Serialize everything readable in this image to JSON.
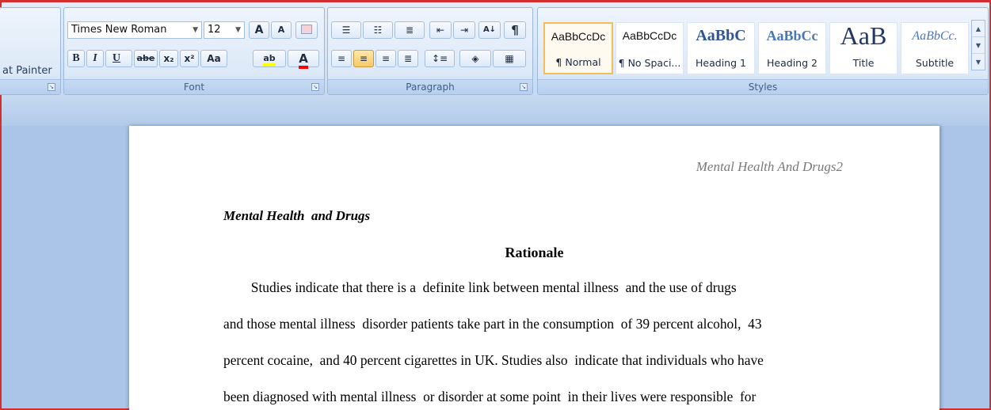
{
  "clipboard": {
    "format_painter_label": "at Painter"
  },
  "font": {
    "name": "Times New Roman",
    "size": "12",
    "group_label": "Font",
    "grow_label": "A",
    "shrink_label": "A",
    "bold_label": "B",
    "italic_label": "I",
    "underline_label": "U",
    "strike_label": "abe",
    "subscript_label": "x₂",
    "superscript_label": "x²",
    "case_label": "Aa",
    "highlight_label": "ab",
    "fontcolor_label": "A"
  },
  "paragraph": {
    "group_label": "Paragraph",
    "show_marks_label": "¶"
  },
  "styles": {
    "group_label": "Styles",
    "items": [
      {
        "sample": "AaBbCcDc",
        "name": "¶ Normal"
      },
      {
        "sample": "AaBbCcDc",
        "name": "¶ No Spaci..."
      },
      {
        "sample": "AaBbC",
        "name": "Heading 1"
      },
      {
        "sample": "AaBbCc",
        "name": "Heading 2"
      },
      {
        "sample": "AaB",
        "name": "Title"
      },
      {
        "sample": "AaBbCc.",
        "name": "Subtitle"
      }
    ]
  },
  "colors": {
    "highlight": "#ffff00",
    "font_color": "#ff0000",
    "heading_blue": "#2f5496",
    "active_style_border": "#f2bd5a"
  },
  "document": {
    "header": "Mental Health And Drugs2",
    "title": "Mental Health  and Drugs",
    "heading": "Rationale",
    "lines": [
      "        Studies indicate that there is a  definite link between mental illness  and the use of drugs",
      "and those mental illness  disorder patients take part in the consumption  of 39 percent alcohol,  43",
      "percent cocaine,  and 40 percent cigarettes in UK. Studies also  indicate that individuals who have",
      "been diagnosed with mental illness  or disorder at some point  in their lives were responsible  for"
    ]
  }
}
